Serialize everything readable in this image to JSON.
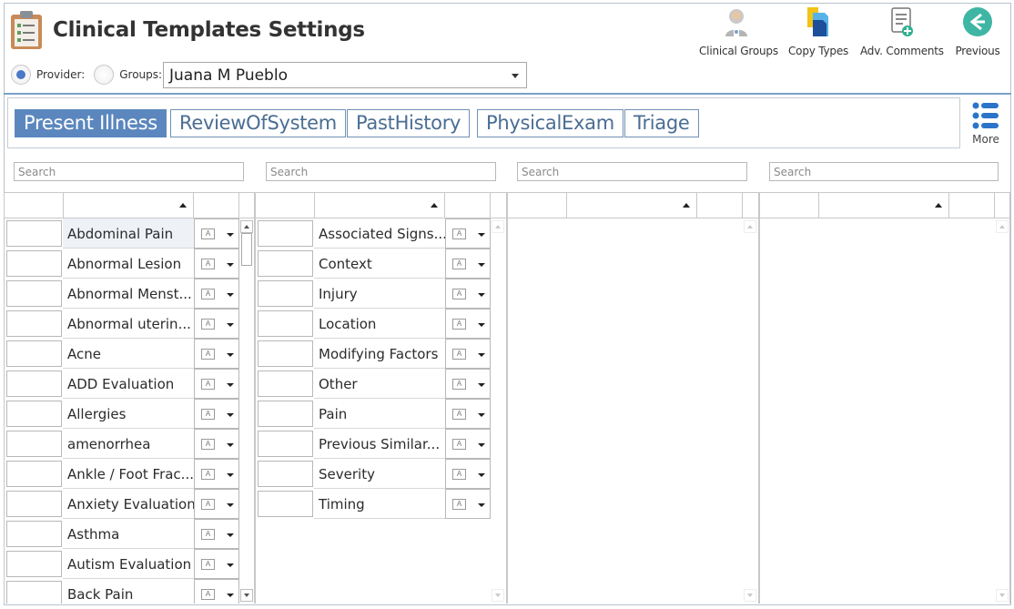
{
  "header": {
    "title": "Clinical Templates Settings",
    "tools": [
      {
        "label": "Clinical Groups",
        "icon": "clinical-groups-icon"
      },
      {
        "label": "Copy Types",
        "icon": "copy-types-icon"
      },
      {
        "label": "Adv. Comments",
        "icon": "adv-comments-icon"
      },
      {
        "label": "Previous",
        "icon": "back-arrow-icon"
      }
    ]
  },
  "filter": {
    "provider_label": "Provider:",
    "groups_label": "Groups:",
    "selected": "provider",
    "provider_value": "Juana M Pueblo"
  },
  "tabs": [
    {
      "label": "Present Illness",
      "active": true
    },
    {
      "label": "ReviewOfSystem",
      "active": false
    },
    {
      "label": "PastHistory",
      "active": false
    },
    {
      "label": "PhysicalExam",
      "active": false
    },
    {
      "label": "Triage",
      "active": false
    }
  ],
  "more_label": "More",
  "search_placeholder": "Search",
  "grid1": {
    "selected_index": 0,
    "rows": [
      "Abdominal Pain",
      "Abnormal Lesion",
      "Abnormal Menst...",
      "Abnormal uterin...",
      "Acne",
      "ADD Evaluation",
      "Allergies",
      "amenorrhea",
      "Ankle / Foot Frac...",
      "Anxiety Evaluation",
      "Asthma",
      "Autism Evaluation",
      "Back Pain"
    ]
  },
  "grid2": {
    "rows": [
      "Associated Signs...",
      "Context",
      "Injury",
      "Location",
      "Modifying Factors",
      "Other",
      "Pain",
      "Previous Similar...",
      "Severity",
      "Timing"
    ]
  },
  "colors": {
    "accent": "#5b87be",
    "tab_text": "#4a6d93",
    "divider": "#7aa0c9"
  }
}
